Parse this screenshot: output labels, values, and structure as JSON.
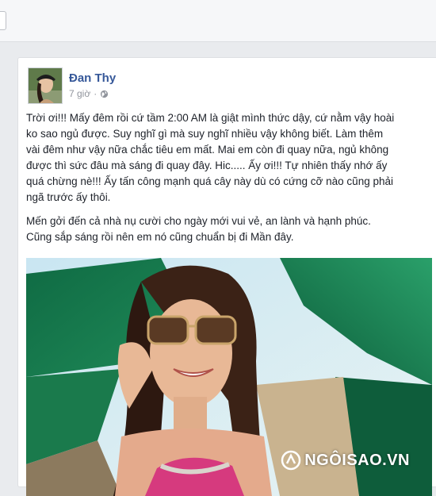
{
  "post": {
    "author": "Đan Thy",
    "time": "7 giờ",
    "separator": "·",
    "paragraphs": [
      "Trời ơi!!! Mấy đêm rồi cứ tầm 2:00 AM là giật mình thức dậy, cứ nằm vậy hoài\nko sao ngủ được. Suy nghĩ gì mà suy nghĩ nhiều vậy không biết. Làm thêm\nvài đêm như vậy nữa chắc tiêu em mất. Mai em còn đi quay nữa, ngủ không\nđược thì sức đâu mà sáng đi quay đây. Hic..... Ấy ơi!!! Tự nhiên thấy nhớ ấy\nquá chừng nè!!! Ấy tấn công mạnh quá cây này dù có cứng cỡ nào cũng phải\nngã trước ấy thôi.",
      "Mến gởi đến cả nhà nụ cười cho ngày mới vui vẻ, an lành và hạnh phúc.\nCũng sắp sáng rồi nên em nó cũng chuẩn bị đi Mần đây."
    ]
  },
  "watermark": {
    "text": "NGÔISAO.VN"
  }
}
